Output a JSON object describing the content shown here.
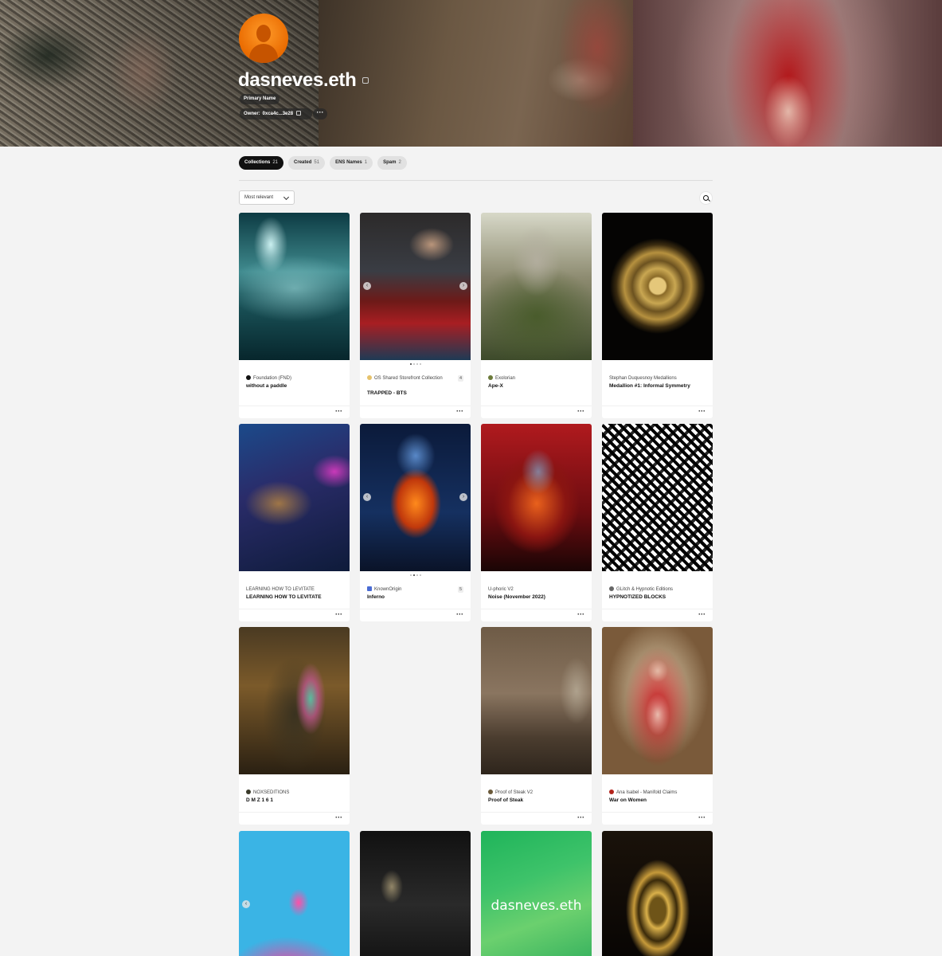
{
  "profile": {
    "name": "dasneves.eth",
    "primary_label": "Primary Name",
    "owner_label": "Owner:",
    "owner_address": "0xca4c...3e28",
    "more": "···"
  },
  "tabs": [
    {
      "label": "Collections",
      "count": "21",
      "active": true
    },
    {
      "label": "Created",
      "count": "51",
      "active": false
    },
    {
      "label": "ENS Names",
      "count": "1",
      "active": false
    },
    {
      "label": "Spam",
      "count": "2",
      "active": false
    }
  ],
  "toolbar": {
    "sort_label": "Most relevant"
  },
  "cards": [
    {
      "collection": "Foundation (FND)",
      "title": "without a paddle",
      "dot": "#111111"
    },
    {
      "collection": "OS Shared Storefront Collection",
      "title": "TRAPPED - BTS",
      "qty": "4",
      "dot": "#e6c26b"
    },
    {
      "collection": "Exolorian",
      "title": "Ape-X",
      "dot": "#6b7a3a"
    },
    {
      "collection": "Stephan Duquesnoy Medallions",
      "title": "Medallion #1: Informal Symmetry"
    },
    {
      "collection": "LEARNING HOW TO LEVITATE",
      "title": "LEARNING HOW TO LEVITATE"
    },
    {
      "collection": "KnownOrigin",
      "title": "Inferno",
      "qty": "5",
      "dot": "#4a6cd4"
    },
    {
      "collection": "U-phoric V2",
      "title": "Noise (November 2022)"
    },
    {
      "collection": "GLitch & Hypnotic Editions",
      "title": "HYPNOTIZED BLOCKS",
      "dot": "#666666"
    },
    {
      "collection": "NOXSEDITIONS",
      "title": "D M Z 1 6 1",
      "dot": "#3a3a2a"
    },
    {
      "collection": "Proof of Steak V2",
      "title": "Proof of Steak",
      "dot": "#6b5a3a"
    },
    {
      "collection": "Ana Isabel - Manifold Claims",
      "title": "War on Women",
      "dot": "#b3241c"
    }
  ],
  "green_card_text": "dasneves.eth",
  "icons": {
    "more": "···",
    "prev": "‹",
    "next": "›"
  }
}
